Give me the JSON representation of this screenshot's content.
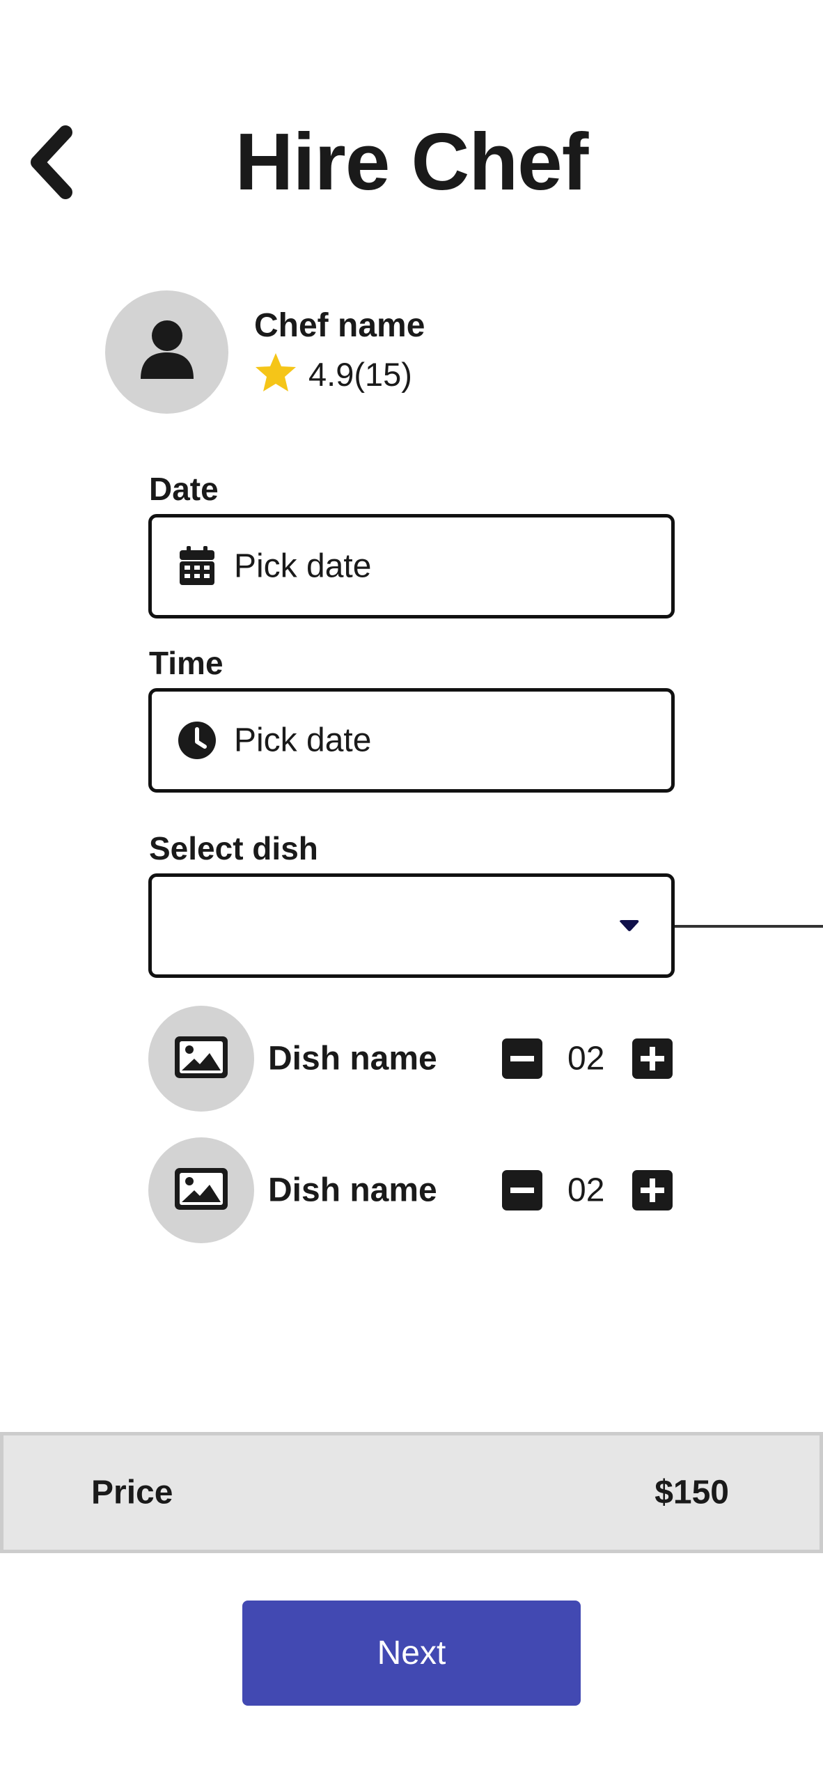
{
  "header": {
    "title": "Hire Chef",
    "back_icon": "chevron-left-icon"
  },
  "chef": {
    "name": "Chef name",
    "rating": "4.9(15)",
    "avatar_icon": "user-icon",
    "star_color": "#f5c518"
  },
  "form": {
    "date": {
      "label": "Date",
      "value": "Pick date",
      "icon": "calendar-icon"
    },
    "time": {
      "label": "Time",
      "value": "Pick date",
      "icon": "clock-icon"
    },
    "dish_select": {
      "label": "Select dish",
      "value": "",
      "icon": "caret-down-icon"
    }
  },
  "dishes": [
    {
      "name": "Dish name",
      "quantity": "02",
      "thumb_icon": "image-icon"
    },
    {
      "name": "Dish name",
      "quantity": "02",
      "thumb_icon": "image-icon"
    }
  ],
  "price": {
    "label": "Price",
    "value": "$150"
  },
  "actions": {
    "next_label": "Next",
    "accent_color": "#4249b2"
  }
}
